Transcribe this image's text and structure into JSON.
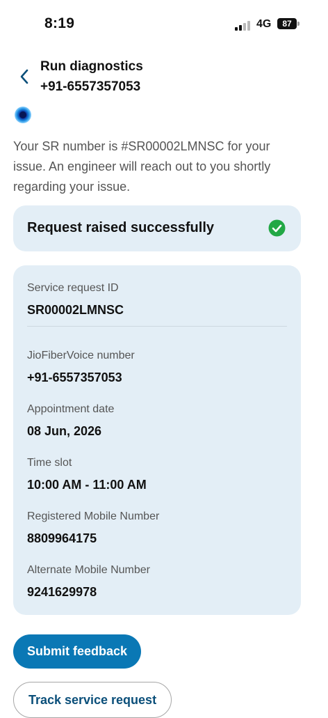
{
  "status_bar": {
    "time": "8:19",
    "network": "4G",
    "battery": "87"
  },
  "header": {
    "title": "Run diagnostics",
    "subtitle": "+91-6557357053"
  },
  "message": "Your SR number is #SR00002LMNSC for your issue. An engineer will reach out to you shortly regarding your issue.",
  "success": {
    "text": "Request raised successfully",
    "color": "#22a845"
  },
  "details": {
    "service_request_id": {
      "label": "Service request ID",
      "value": "SR00002LMNSC"
    },
    "voice_number": {
      "label": "JioFiberVoice number",
      "value": "+91-6557357053"
    },
    "appointment_date": {
      "label": "Appointment date",
      "value": "08 Jun, 2026"
    },
    "time_slot": {
      "label": "Time slot",
      "value": "10:00 AM - 11:00 AM"
    },
    "registered_mobile": {
      "label": "Registered Mobile Number",
      "value": "8809964175"
    },
    "alternate_mobile": {
      "label": "Alternate Mobile Number",
      "value": "9241629978"
    }
  },
  "buttons": {
    "submit_feedback": "Submit feedback",
    "track_service_request": "Track service request"
  },
  "colors": {
    "accent": "#0a78b5",
    "card_bg": "#e3eef6",
    "secondary_text": "#0b4f7a"
  },
  "icons": {
    "back": "chevron-left-icon",
    "bot": "assistant-orb-icon",
    "success": "check-circle-icon"
  }
}
